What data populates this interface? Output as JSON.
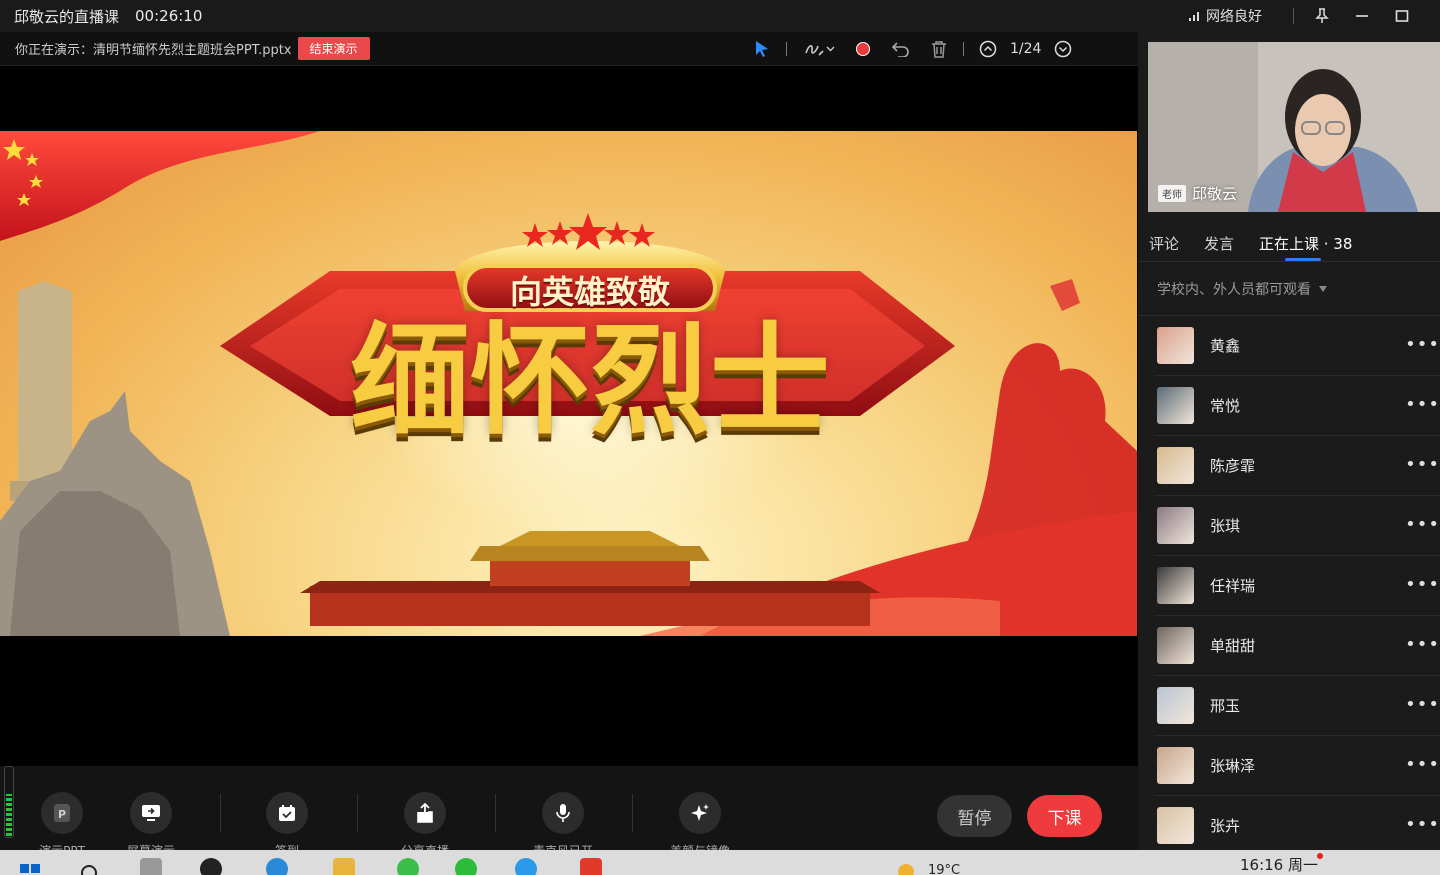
{
  "titlebar": {
    "title": "邱敬云的直播课",
    "timer": "00:26:10",
    "network": "网络良好"
  },
  "presentbar": {
    "presenting_text": "你正在演示：清明节缅怀先烈主题班会PPT.pptx",
    "end_presenting": "结束演示",
    "page": "1/24"
  },
  "slide": {
    "banner_text": "向英雄致敬",
    "main_title": "缅怀烈士"
  },
  "bottombar": {
    "buttons": [
      {
        "label": "演示PPT",
        "icon": "ppt-icon"
      },
      {
        "label": "屏幕演示",
        "icon": "screen-share-icon"
      },
      {
        "label": "签到",
        "icon": "checkin-icon"
      },
      {
        "label": "分享直播",
        "icon": "share-icon"
      },
      {
        "label": "麦克风已开",
        "icon": "microphone-icon"
      },
      {
        "label": "美颜与镜像",
        "icon": "beauty-icon"
      }
    ],
    "pause": "暂停",
    "end_class": "下课",
    "mic_level": 0.6
  },
  "rightpanel": {
    "teacher_role": "老师",
    "teacher_name": "邱敬云",
    "tabs": [
      "评论",
      "发言",
      "正在上课 · 38"
    ],
    "visibility": "学校内、外人员都可观看",
    "participants": [
      {
        "name": "黄鑫",
        "color": "#d9a08c"
      },
      {
        "name": "常悦",
        "color": "#5b6b78"
      },
      {
        "name": "陈彦霏",
        "color": "#d6b98f"
      },
      {
        "name": "张琪",
        "color": "#8a7a86"
      },
      {
        "name": "任祥瑞",
        "color": "#3a3a3a"
      },
      {
        "name": "单甜甜",
        "color": "#6f6460"
      },
      {
        "name": "邢玉",
        "color": "#b9c5d3"
      },
      {
        "name": "张琳泽",
        "color": "#c9a58a"
      },
      {
        "name": "张卉",
        "color": "#d8c2a4"
      }
    ]
  },
  "taskbar": {
    "temperature": "19°C",
    "clock": "16:16 周一"
  }
}
